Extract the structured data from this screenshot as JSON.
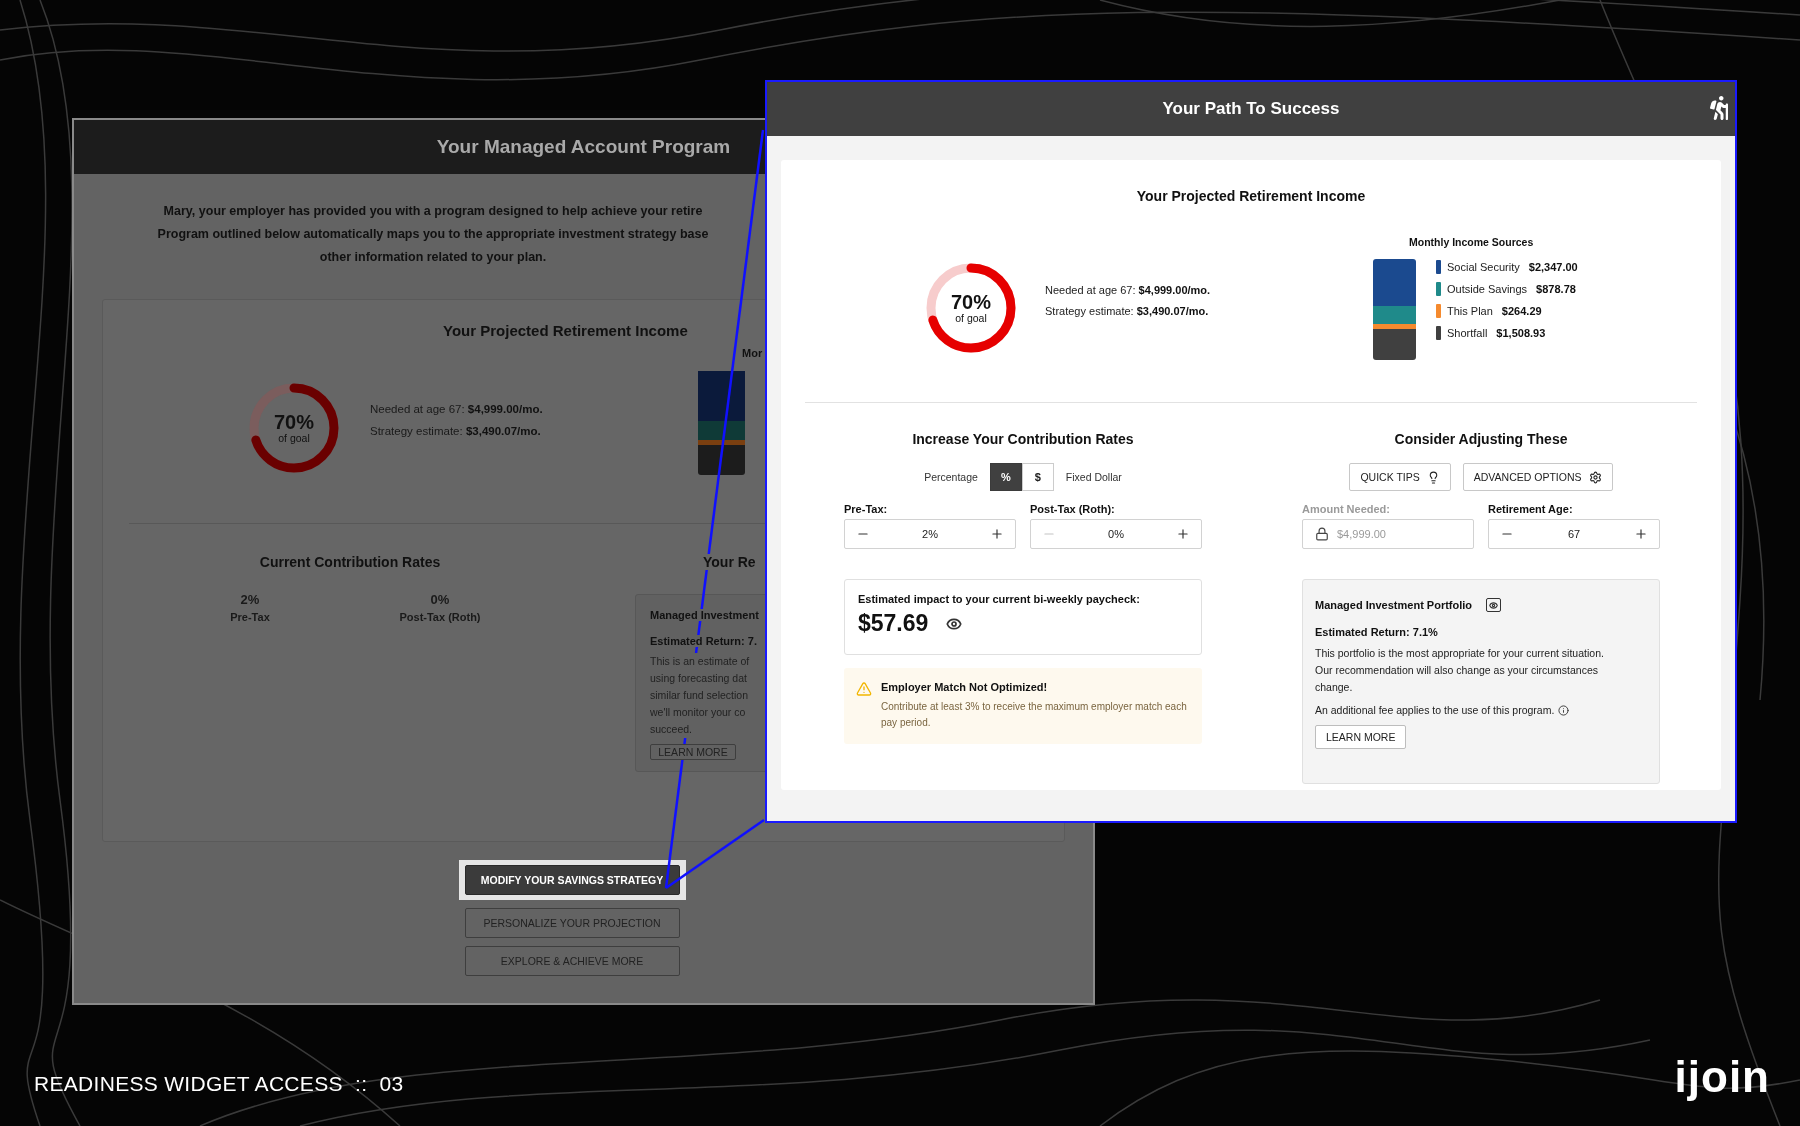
{
  "back_window": {
    "title": "Your Managed Account Program",
    "intro_lines": [
      "Mary, your employer has provided you with a program designed to help achieve your retire",
      "Program outlined below automatically maps you to the appropriate investment strategy base",
      "other information related to your plan."
    ],
    "projection": {
      "title": "Your Projected Retirement Income",
      "donut": {
        "percent": "70%",
        "caption": "of goal",
        "level": 0.7
      },
      "needed_label": "Needed at age 67:",
      "needed_value": "$4,999.00/mo.",
      "estimate_label": "Strategy estimate:",
      "estimate_value": "$3,490.07/mo.",
      "sources_title": "Mor"
    },
    "contributions": {
      "title": "Current Contribution Rates",
      "items": [
        {
          "value": "2%",
          "label": "Pre-Tax"
        },
        {
          "value": "0%",
          "label": "Post-Tax (Roth)"
        }
      ]
    },
    "recommendation": {
      "title": "Your Re",
      "card_title": "Managed Investment",
      "card_return": "Estimated Return: 7.",
      "card_lines": [
        "This is an estimate of",
        "using forecasting dat",
        "similar fund selection",
        "we'll monitor your co",
        "succeed."
      ],
      "button": "LEARN MORE"
    },
    "actions": [
      {
        "label": "MODIFY YOUR SAVINGS STRATEGY",
        "selected": true
      },
      {
        "label": "PERSONALIZE YOUR PROJECTION",
        "selected": false
      },
      {
        "label": "EXPLORE & ACHIEVE MORE",
        "selected": false
      }
    ]
  },
  "front_window": {
    "title": "Your Path To Success",
    "projection": {
      "title": "Your Projected Retirement Income",
      "donut": {
        "percent": "70%",
        "caption": "of goal",
        "level": 0.7
      },
      "needed_label": "Needed at age 67:",
      "needed_value": "$4,999.00/mo.",
      "estimate_label": "Strategy estimate:",
      "estimate_value": "$3,490.07/mo.",
      "sources_title": "Monthly Income Sources",
      "sources": [
        {
          "label": "Social Security",
          "value": "$2,347.00",
          "color": "#1b4a8f"
        },
        {
          "label": "Outside Savings",
          "value": "$878.78",
          "color": "#1f8a8a"
        },
        {
          "label": "This Plan",
          "value": "$264.29",
          "color": "#f58a2e"
        },
        {
          "label": "Shortfall",
          "value": "$1,508.93",
          "color": "#404040"
        }
      ]
    },
    "contribution": {
      "title": "Increase Your Contribution Rates",
      "left_label": "Percentage",
      "right_label": "Fixed Dollar",
      "modes": [
        {
          "label": "%",
          "selected": true
        },
        {
          "label": "$",
          "selected": false
        }
      ],
      "fields": [
        {
          "label": "Pre-Tax:",
          "value": "2%",
          "minus_disabled": false
        },
        {
          "label": "Post-Tax (Roth):",
          "value": "0%",
          "minus_disabled": true
        }
      ],
      "impact_label": "Estimated impact to your current bi-weekly paycheck:",
      "impact_value": "$57.69",
      "warning_title": "Employer Match Not Optimized!",
      "warning_text": "Contribute at least 3% to receive the maximum employer match each pay period."
    },
    "adjust": {
      "title": "Consider Adjusting These",
      "buttons": [
        {
          "kind": "tips",
          "label": "QUICK TIPS"
        },
        {
          "kind": "advanced",
          "label": "ADVANCED OPTIONS"
        }
      ],
      "amount": {
        "label": "Amount Needed:",
        "value": "$4,999.00",
        "locked": true
      },
      "age": {
        "label": "Retirement Age:",
        "value": "67",
        "minus_disabled": false
      },
      "portfolio": {
        "title": "Managed Investment Portfolio",
        "return": "Estimated Return: 7.1%",
        "text": "This portfolio is the most appropriate for your current situation. Our recommendation will also change as your circumstances change.",
        "fee": "An additional fee applies to the use of this program.",
        "button": "LEARN MORE"
      }
    }
  },
  "caption": "READINESS WIDGET ACCESS  ::  03",
  "logo": "ijoin"
}
